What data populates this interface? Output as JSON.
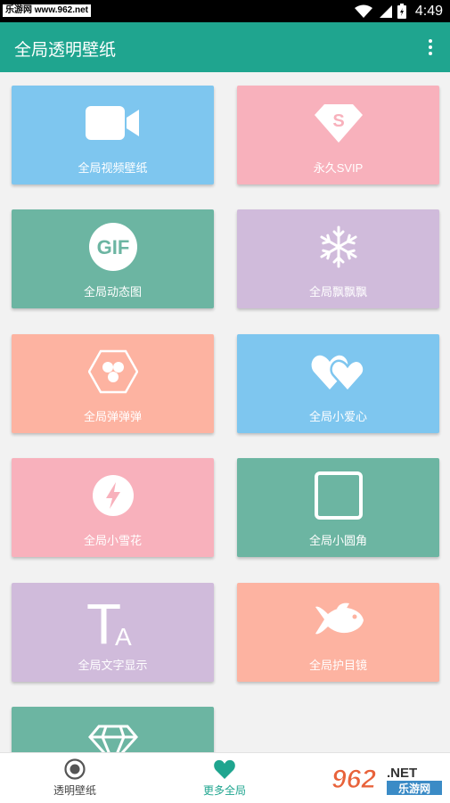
{
  "status_bar": {
    "watermark": "乐游网 www.962.net",
    "time": "4:49"
  },
  "app_bar": {
    "title": "全局透明壁纸"
  },
  "colors": {
    "primary": "#1fa58f",
    "blue": "#7ec6ef",
    "pink": "#f8b1bc",
    "green": "#6cb5a2",
    "purple": "#d0bbdb",
    "salmon": "#fdb3a1"
  },
  "cards": [
    {
      "label": "全局视频壁纸",
      "icon": "video-camera-icon"
    },
    {
      "label": "永久SVIP",
      "icon": "svip-diamond-icon"
    },
    {
      "label": "全局动态图",
      "icon": "gif-icon"
    },
    {
      "label": "全局飘飘飘",
      "icon": "snowflake-icon"
    },
    {
      "label": "全局弹弹弹",
      "icon": "hexagon-balls-icon"
    },
    {
      "label": "全局小爱心",
      "icon": "hearts-icon"
    },
    {
      "label": "全局小雪花",
      "icon": "lightning-circle-icon"
    },
    {
      "label": "全局小圆角",
      "icon": "rounded-square-icon"
    },
    {
      "label": "全局文字显示",
      "icon": "text-icon"
    },
    {
      "label": "全局护目镜",
      "icon": "fish-icon"
    },
    {
      "label": "",
      "icon": "diamond-icon"
    }
  ],
  "icon_text": {
    "gif": "GIF",
    "svip": "S",
    "text_big": "T",
    "text_small": "A"
  },
  "bottom_nav": [
    {
      "label": "透明壁纸",
      "icon": "radio-circle-icon"
    },
    {
      "label": "更多全局",
      "icon": "heart-icon",
      "active": true
    }
  ],
  "watermark_logo": {
    "number": "962",
    "dot_net": ".NET",
    "name": "乐游网"
  }
}
